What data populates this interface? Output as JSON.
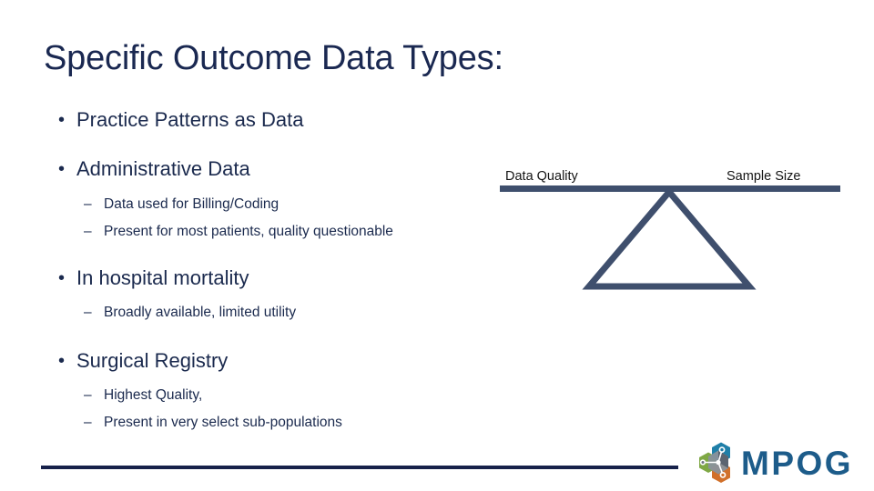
{
  "slide": {
    "title": "Specific Outcome Data Types:",
    "title_color": "#1a2851",
    "body_color": "#1b2a4e",
    "background": "#ffffff"
  },
  "content": {
    "bullet_glyph": "•",
    "dash_glyph": "–",
    "items": [
      {
        "level": 1,
        "text": "Practice Patterns as Data"
      },
      {
        "level": 1,
        "text": "Administrative Data"
      },
      {
        "level": 2,
        "text": "Data used for Billing/Coding"
      },
      {
        "level": 2,
        "text": "Present for most patients, quality questionable"
      },
      {
        "level": 1,
        "text": "In hospital mortality"
      },
      {
        "level": 2,
        "text": "Broadly available, limited utility"
      },
      {
        "level": 1,
        "text": "Surgical Registry"
      },
      {
        "level": 2,
        "text": "Highest Quality,"
      },
      {
        "level": 2,
        "text": "Present in very select sub-populations"
      }
    ]
  },
  "diagram": {
    "name": "balance-scale",
    "left_label": "Data Quality",
    "right_label": "Sample Size",
    "stroke_color": "#3f4f6d",
    "beam_thickness_px": 7,
    "fulcrum_shape": "triangle"
  },
  "footer": {
    "rule_color": "#17214a",
    "logo": {
      "wordmark": "MPOG",
      "wordmark_color": "#1d5c8a",
      "mark_colors": {
        "green": "#7fa845",
        "teal": "#1f7fa8",
        "slate": "#6d7580",
        "orange": "#d1702a",
        "dark_slate": "#4a5560"
      }
    }
  }
}
